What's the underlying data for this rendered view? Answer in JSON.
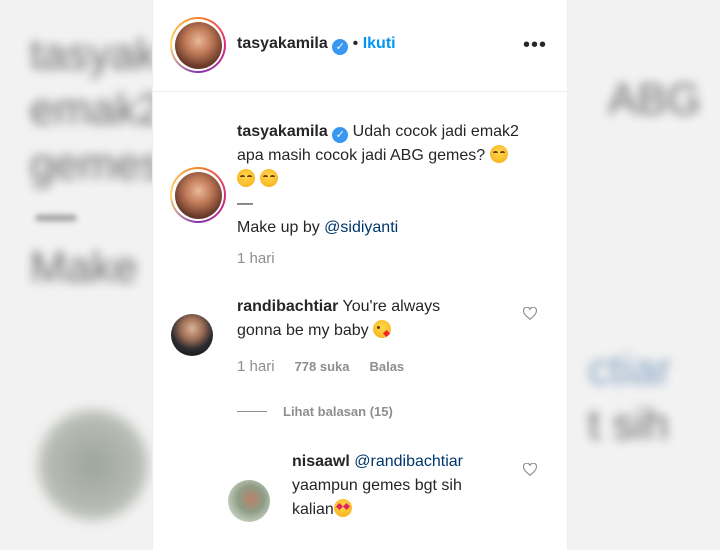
{
  "post": {
    "author": "tasyakamila",
    "follow_label": "Ikuti",
    "dot": "•",
    "more_label": "•••",
    "verified_mark": "✓"
  },
  "caption": {
    "author": "tasyakamila",
    "text_line1": "Udah cocok jadi emak2",
    "text_line2": "apa masih cocok jadi ABG gemes?",
    "dash": "—",
    "makeup_prefix": "Make up by ",
    "makeup_mention": "@sidiyanti",
    "time": "1 hari",
    "emoji": "blush-face-emoji"
  },
  "comments": [
    {
      "author": "randibachtiar",
      "text_line1": "You're always",
      "text_line2": "gonna be my baby",
      "emoji": "kiss-face-emoji",
      "time": "1 hari",
      "likes": "778 suka",
      "reply_label": "Balas",
      "view_replies": "Lihat balasan (15)"
    },
    {
      "author": "nisaawl",
      "mention": "@randibachtiar",
      "text_line1": "yaampun gemes bgt sih",
      "text_line2": "kalian",
      "emoji": "heart-eyes-emoji"
    }
  ],
  "background": {
    "ghost_lines": [
      "tasyak",
      "emak2",
      "gemes",
      "Make"
    ],
    "ghost_right": [
      "ABG",
      "ctiar",
      "t sih"
    ]
  },
  "colors": {
    "accent": "#0095f6",
    "mention": "#00376b",
    "meta": "#8e8e8e",
    "verified": "#3897f0"
  }
}
